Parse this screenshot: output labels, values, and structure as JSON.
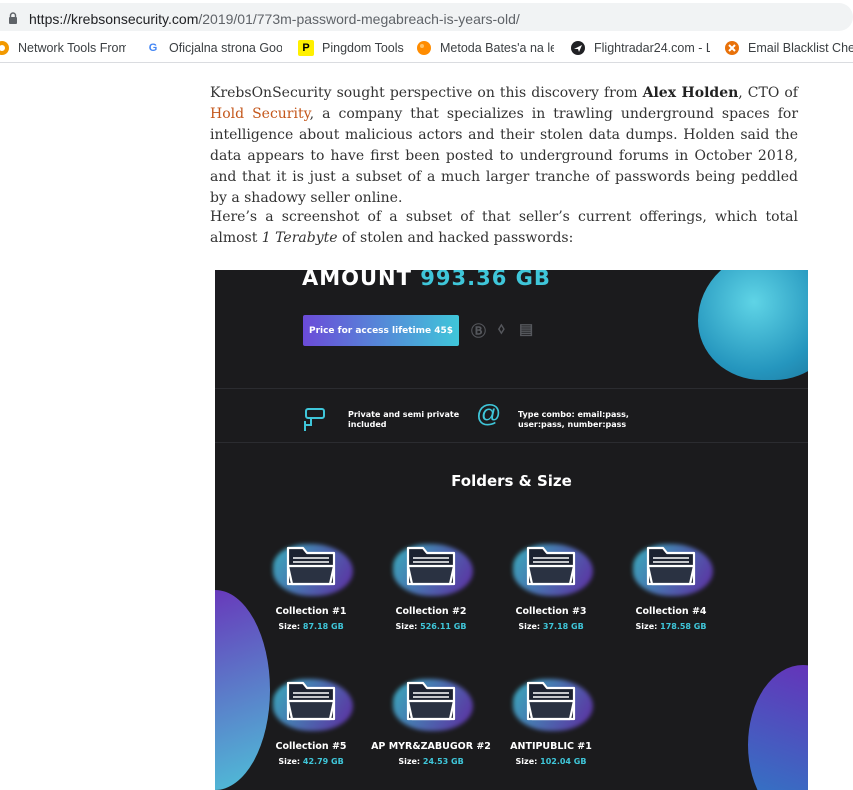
{
  "browser": {
    "url_host": "https://krebsonsecurity.com",
    "url_path": "/2019/01/773m-password-megabreach-is-years-old/",
    "bookmarks": [
      {
        "label": "Network Tools From I",
        "icon": "tools-icon",
        "color": "#f29900"
      },
      {
        "label": "Oficjalna strona Goo",
        "icon": "google-icon",
        "color": "#4285f4"
      },
      {
        "label": "Pingdom Tools",
        "icon": "pingdom-icon",
        "color": "#fff000"
      },
      {
        "label": "Metoda Bates'a na le",
        "icon": "orange-icon",
        "color": "#ff8c00"
      },
      {
        "label": "Flightradar24.com - L",
        "icon": "flightradar-icon",
        "color": "#202124"
      },
      {
        "label": "Email Blacklist Chec",
        "icon": "mxtoolbox-icon",
        "color": "#e8710a"
      }
    ]
  },
  "article": {
    "p1_before": "KrebsOnSecurity sought perspective on this discovery from ",
    "p1_name": "Alex Holden",
    "p1_mid": ", CTO of ",
    "p1_link": "Hold Security",
    "p1_after": ", a company that specializes in trawling underground spaces for intelligence about malicious actors and their stolen data dumps. Holden said the data appears to have first been posted to underground forums in October 2018, and that it is just a subset of a much larger tranche of passwords being peddled by a shadowy seller online.",
    "p2_before": "Here’s a screenshot of a subset of that seller’s current offerings, which total almost ",
    "p2_em": "1 Terabyte",
    "p2_after": " of stolen and hacked passwords:"
  },
  "offering": {
    "amount_label": "AMOUNT",
    "amount_value": "993.36 GB",
    "price_button": "Price for access lifetime 45$",
    "feature1": "Private and semi private included",
    "feature2": "Type combo: email:pass, user:pass, number:pass",
    "folders_title": "Folders & Size",
    "size_label": "Size:",
    "folders": [
      {
        "name": "Collection #1",
        "size": "87.18 GB"
      },
      {
        "name": "Collection #2",
        "size": "526.11 GB"
      },
      {
        "name": "Collection #3",
        "size": "37.18 GB"
      },
      {
        "name": "Collection #4",
        "size": "178.58 GB"
      },
      {
        "name": "Collection #5",
        "size": "42.79 GB"
      },
      {
        "name": "AP MYR&ZABUGOR #2",
        "size": "24.53 GB"
      },
      {
        "name": "ANTIPUBLIC #1",
        "size": "102.04 GB"
      }
    ]
  }
}
